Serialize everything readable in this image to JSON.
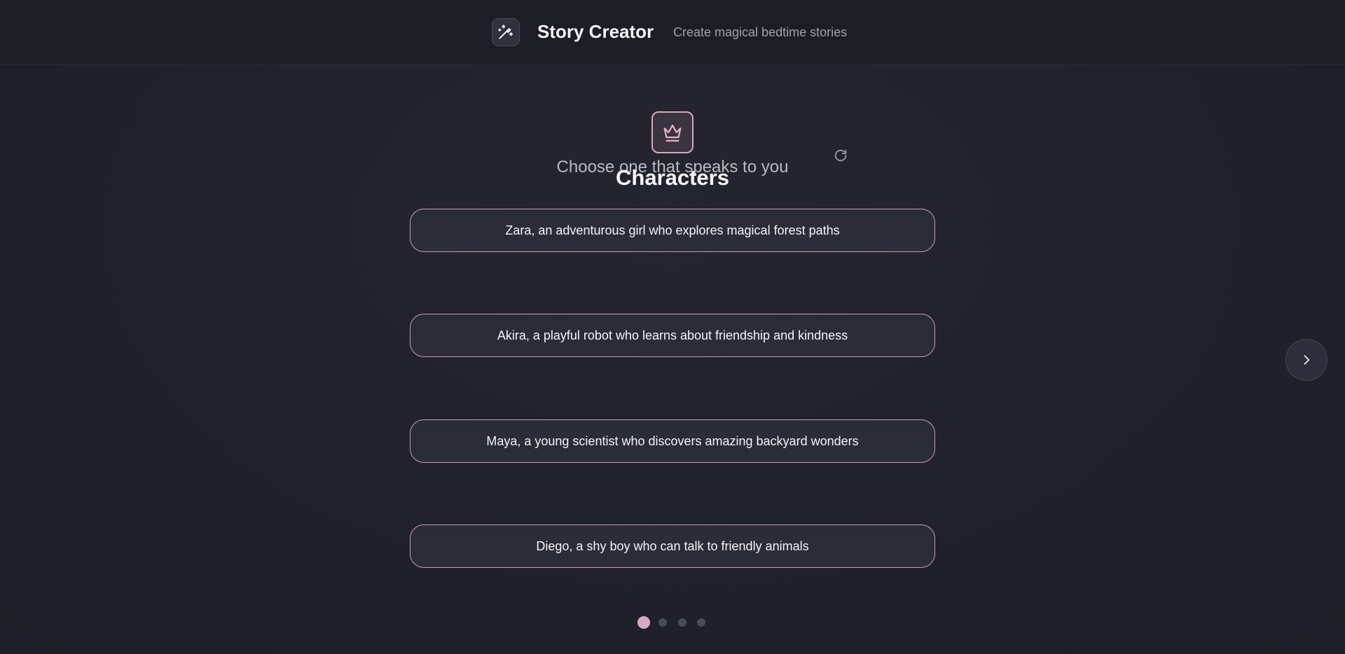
{
  "header": {
    "title": "Story Creator",
    "subtitle": "Create magical bedtime stories",
    "logo_icon": "magic-wand-icon"
  },
  "section": {
    "icon": "crown-icon",
    "title": "Characters",
    "prompt": "Choose one that speaks to you",
    "refresh_icon": "refresh-icon"
  },
  "options": [
    "Zara, an adventurous girl who explores magical forest paths",
    "Akira, a playful robot who learns about friendship and kindness",
    "Maya, a young scientist who discovers amazing backyard wonders",
    "Diego, a shy boy who can talk to friendly animals"
  ],
  "navigation": {
    "next_icon": "chevron-right-icon",
    "pages": 4,
    "current_page": 1
  },
  "colors": {
    "accent": "#d8a8bd",
    "background": "#20212b",
    "card": "#2b2c38"
  }
}
